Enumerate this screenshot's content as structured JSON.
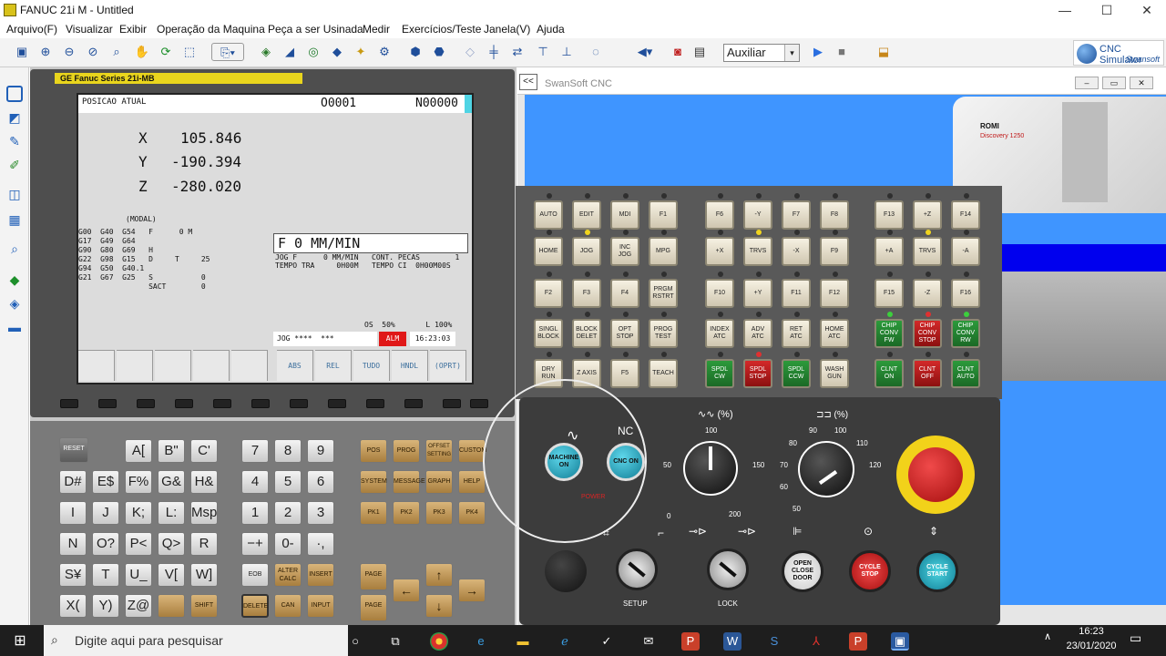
{
  "window": {
    "title": "FANUC 21i M - Untitled",
    "min": "—",
    "max": "☐",
    "close": "✕"
  },
  "menu": [
    "Arquivo(F)",
    "Visualizar",
    "Exibir",
    "Operação da Maquina",
    "Peça a ser Usinada",
    "Medir",
    "Exercícios/Teste",
    "Janela(V)",
    "Ajuda"
  ],
  "toolbar": {
    "mode_select": "Auxiliar",
    "mode_arrow": "▾"
  },
  "logo": {
    "line1": "CNC Simulator",
    "line2": "Swansoft"
  },
  "cnc": {
    "brand": "GE Fanuc   Series 21i-MB",
    "screen": {
      "title": "POSICAO ATUAL",
      "prog": "O0001",
      "seq": "N00000",
      "axes": [
        {
          "axis": "X",
          "value": "105.846"
        },
        {
          "axis": "Y",
          "value": "-190.394"
        },
        {
          "axis": "Z",
          "value": "-280.020"
        }
      ],
      "modal_title": "(MODAL)",
      "modal_lines": [
        "G00  G40  G54   F      0 M",
        "G17  G49  G64",
        "G90  G80  G69   H",
        "G22  G98  G15   D     T     25",
        "G94  G50  G40.1",
        "G21  G67  G25   S           0",
        "                SACT        0"
      ],
      "feed": "F      0  MM/MIN",
      "info_left": "JOG F      0 MM/MIN\nTEMPO TRA     0H00M",
      "info_right": "CONT. PECAS        1\nTEMPO CI  0H00M00S",
      "status_right": "OS  50%       L 100%",
      "jog_text": "JOG ****  ***",
      "alm": "ALM",
      "clock": "16:23:03",
      "softkeys": [
        "ABS",
        "REL",
        "TUDO",
        "HNDL",
        "(OPRT)"
      ]
    },
    "keys": {
      "reset": "RESET",
      "alpha": [
        "A[",
        "B\"",
        "C'",
        "D#",
        "E$",
        "F%",
        "G&",
        "H&",
        "I",
        "J",
        "K;",
        "L:",
        "Msp",
        "N",
        "O?",
        "P<",
        "Q>",
        "R",
        "S¥",
        "T",
        "U_",
        "V[",
        "W]",
        "X(",
        "Y)",
        "Z@"
      ],
      "numeric": [
        "7",
        "8",
        "9",
        "4",
        "5",
        "6",
        "1",
        "2",
        "3",
        "−+",
        "0-",
        "·,"
      ],
      "func": [
        "POS",
        "PROG",
        "OFFSET SETTING",
        "CUSTOM",
        "SYSTEM",
        "MESSAGE",
        "GRAPH",
        "HELP",
        "PK1",
        "PK2",
        "PK3",
        "PK4"
      ],
      "edit": [
        "EOB",
        "ALTER CALC",
        "INSERT",
        "SHIFT",
        "DELETE",
        "CAN",
        "INPUT"
      ],
      "page_up": "PAGE",
      "page_down": "PAGE",
      "arrows": {
        "up": "↑",
        "down": "↓",
        "left": "←",
        "right": "→"
      }
    }
  },
  "sim": {
    "title": "SwanSoft CNC",
    "collapse": "<<",
    "machine_brand": "ROMI",
    "machine_model": "Discovery 1250",
    "panel_rows": [
      [
        "AUTO",
        "EDIT",
        "MDI",
        "F1",
        "F6",
        "-Y",
        "F7",
        "F8",
        "F13",
        "+Z",
        "F14"
      ],
      [
        "HOME",
        "JOG",
        "INC JOG",
        "MPG",
        "+X",
        "TRVS",
        "-X",
        "F9",
        "+A",
        "TRVS",
        "-A"
      ],
      [
        "F2",
        "F3",
        "F4",
        "PRGM RSTRT",
        "F10",
        "+Y",
        "F11",
        "F12",
        "F15",
        "-Z",
        "F16"
      ],
      [
        "SINGL BLOCK",
        "BLOCK DELET",
        "OPT STOP",
        "PROG TEST",
        "INDEX ATC",
        "ADV ATC",
        "RET ATC",
        "HOME ATC",
        "CHIP CONV FW",
        "CHIP CONV STOP",
        "CHIP CONV RW"
      ],
      [
        "DRY RUN",
        "Z AXIS",
        "F5",
        "TEACH",
        "SPDL CW",
        "SPDL STOP",
        "SPDL CCW",
        "WASH GUN",
        "CLNT ON",
        "CLNT OFF",
        "CLNT AUTO"
      ]
    ],
    "power": {
      "ac_symbol": "∿",
      "nc_label": "NC",
      "machine_on": "MACHINE ON",
      "cnc_on": "CNC ON",
      "power_label": "POWER"
    },
    "feed_override": {
      "label": "(%)",
      "ticks": [
        "0",
        "50",
        "100",
        "150",
        "200"
      ]
    },
    "spindle_override": {
      "label": "(%)",
      "ticks": [
        "50",
        "60",
        "70",
        "80",
        "90",
        "100",
        "110",
        "120"
      ]
    },
    "bottom": {
      "setup": "SETUP",
      "lock": "LOCK",
      "open_close_door": "OPEN CLOSE DOOR",
      "cycle_stop": "CYCLE STOP",
      "cycle_start": "CYCLE START"
    }
  },
  "taskbar": {
    "search_placeholder": "Digite aqui para pesquisar",
    "time": "16:23",
    "date": "23/01/2020"
  },
  "colors": {
    "screen_bg": "#dcdcdc",
    "ge_yellow": "#e9d51d",
    "alm_red": "#e01818",
    "estop_red": "#e01818",
    "estop_ring": "#f2d21a",
    "cnc_on_cyan": "#1aa7c3",
    "viewport_blue": "#3f95ff"
  }
}
